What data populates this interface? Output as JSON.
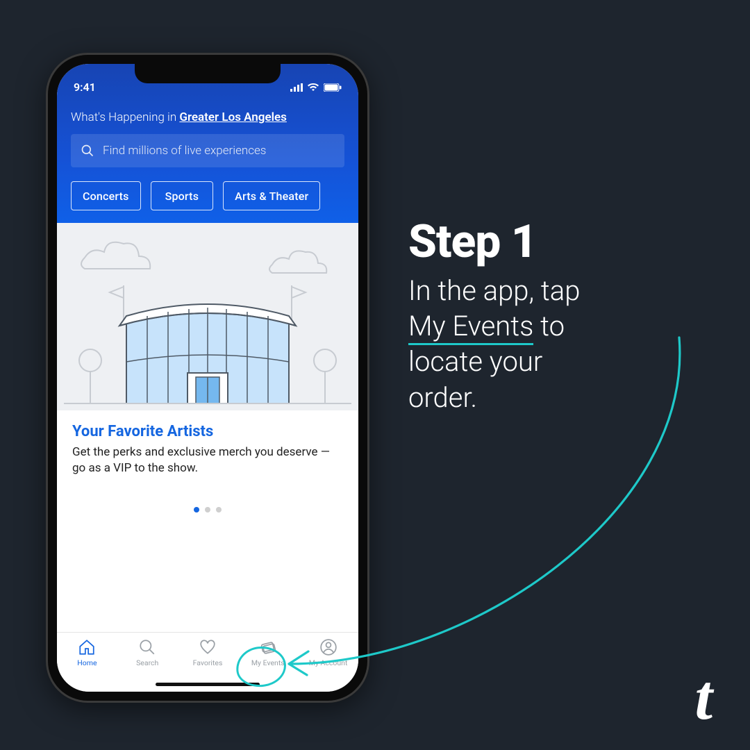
{
  "status": {
    "time": "9:41"
  },
  "header": {
    "prefix": "What's Happening in ",
    "location": "Greater Los Angeles",
    "search_placeholder": "Find millions of live experiences",
    "categories": [
      "Concerts",
      "Sports",
      "Arts & Theater"
    ]
  },
  "card": {
    "title": "Your Favorite Artists",
    "body": "Get the perks and exclusive merch you deserve — go as a VIP to the show."
  },
  "tabs": {
    "home": "Home",
    "search": "Search",
    "favorites": "Favorites",
    "my_events": "My Events",
    "my_account": "My Account"
  },
  "annotation": {
    "step_title": "Step 1",
    "line1": "In the app, tap",
    "emphasis": "My Events",
    "line1_suffix": " to",
    "line2": "locate your",
    "line3": "order."
  },
  "brand": {
    "glyph": "t"
  }
}
